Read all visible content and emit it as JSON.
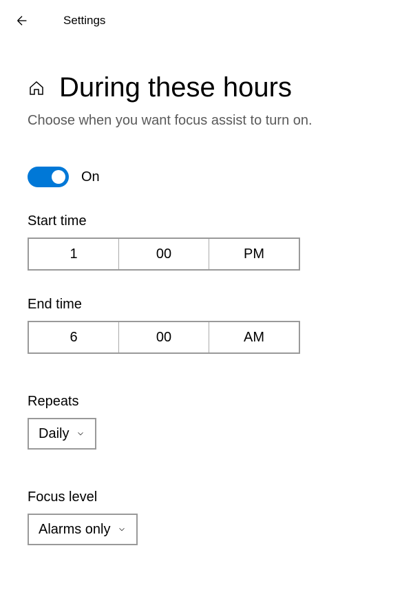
{
  "header": {
    "title": "Settings"
  },
  "page": {
    "title": "During these hours",
    "description": "Choose when you want focus assist to turn on."
  },
  "toggle": {
    "state": "On"
  },
  "start_time": {
    "label": "Start time",
    "hour": "1",
    "minute": "00",
    "period": "PM"
  },
  "end_time": {
    "label": "End time",
    "hour": "6",
    "minute": "00",
    "period": "AM"
  },
  "repeats": {
    "label": "Repeats",
    "value": "Daily"
  },
  "focus_level": {
    "label": "Focus level",
    "value": "Alarms only"
  }
}
